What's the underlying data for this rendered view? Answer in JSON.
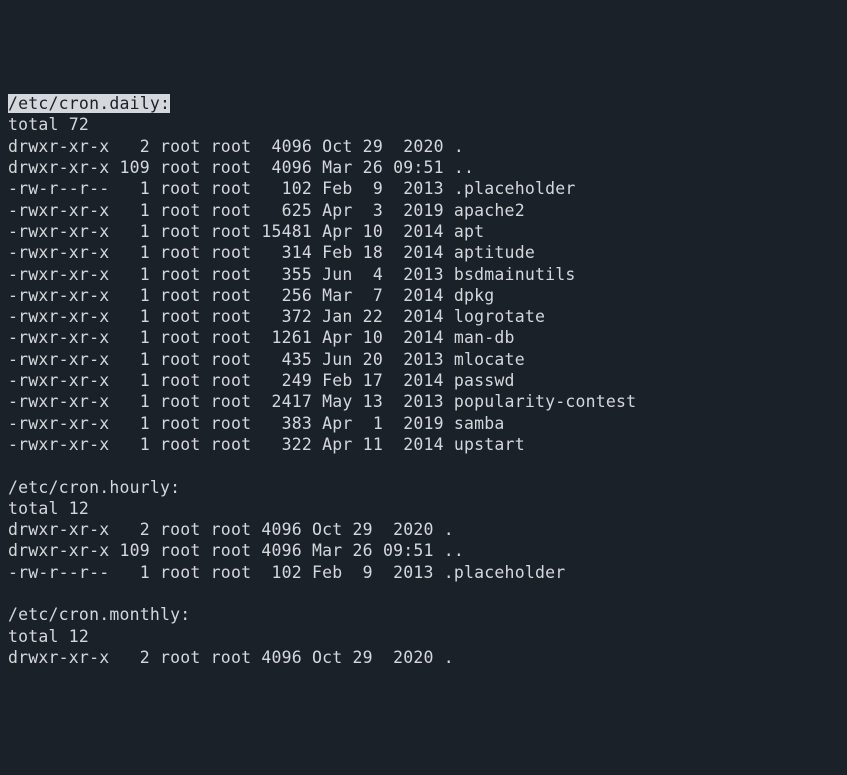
{
  "sections": [
    {
      "header": "/etc/cron.daily:",
      "highlighted": true,
      "total": "total 72",
      "rows": [
        {
          "perm": "drwxr-xr-x",
          "links": "2",
          "owner": "root",
          "group": "root",
          "size": "4096",
          "date": "Oct 29  2020",
          "name": "."
        },
        {
          "perm": "drwxr-xr-x",
          "links": "109",
          "owner": "root",
          "group": "root",
          "size": "4096",
          "date": "Mar 26 09:51",
          "name": ".."
        },
        {
          "perm": "-rw-r--r--",
          "links": "1",
          "owner": "root",
          "group": "root",
          "size": "102",
          "date": "Feb  9  2013",
          "name": ".placeholder"
        },
        {
          "perm": "-rwxr-xr-x",
          "links": "1",
          "owner": "root",
          "group": "root",
          "size": "625",
          "date": "Apr  3  2019",
          "name": "apache2"
        },
        {
          "perm": "-rwxr-xr-x",
          "links": "1",
          "owner": "root",
          "group": "root",
          "size": "15481",
          "date": "Apr 10  2014",
          "name": "apt"
        },
        {
          "perm": "-rwxr-xr-x",
          "links": "1",
          "owner": "root",
          "group": "root",
          "size": "314",
          "date": "Feb 18  2014",
          "name": "aptitude"
        },
        {
          "perm": "-rwxr-xr-x",
          "links": "1",
          "owner": "root",
          "group": "root",
          "size": "355",
          "date": "Jun  4  2013",
          "name": "bsdmainutils"
        },
        {
          "perm": "-rwxr-xr-x",
          "links": "1",
          "owner": "root",
          "group": "root",
          "size": "256",
          "date": "Mar  7  2014",
          "name": "dpkg"
        },
        {
          "perm": "-rwxr-xr-x",
          "links": "1",
          "owner": "root",
          "group": "root",
          "size": "372",
          "date": "Jan 22  2014",
          "name": "logrotate"
        },
        {
          "perm": "-rwxr-xr-x",
          "links": "1",
          "owner": "root",
          "group": "root",
          "size": "1261",
          "date": "Apr 10  2014",
          "name": "man-db"
        },
        {
          "perm": "-rwxr-xr-x",
          "links": "1",
          "owner": "root",
          "group": "root",
          "size": "435",
          "date": "Jun 20  2013",
          "name": "mlocate"
        },
        {
          "perm": "-rwxr-xr-x",
          "links": "1",
          "owner": "root",
          "group": "root",
          "size": "249",
          "date": "Feb 17  2014",
          "name": "passwd"
        },
        {
          "perm": "-rwxr-xr-x",
          "links": "1",
          "owner": "root",
          "group": "root",
          "size": "2417",
          "date": "May 13  2013",
          "name": "popularity-contest"
        },
        {
          "perm": "-rwxr-xr-x",
          "links": "1",
          "owner": "root",
          "group": "root",
          "size": "383",
          "date": "Apr  1  2019",
          "name": "samba"
        },
        {
          "perm": "-rwxr-xr-x",
          "links": "1",
          "owner": "root",
          "group": "root",
          "size": "322",
          "date": "Apr 11  2014",
          "name": "upstart"
        }
      ],
      "sizeWidth": 5
    },
    {
      "header": "/etc/cron.hourly:",
      "highlighted": false,
      "total": "total 12",
      "rows": [
        {
          "perm": "drwxr-xr-x",
          "links": "2",
          "owner": "root",
          "group": "root",
          "size": "4096",
          "date": "Oct 29  2020",
          "name": "."
        },
        {
          "perm": "drwxr-xr-x",
          "links": "109",
          "owner": "root",
          "group": "root",
          "size": "4096",
          "date": "Mar 26 09:51",
          "name": ".."
        },
        {
          "perm": "-rw-r--r--",
          "links": "1",
          "owner": "root",
          "group": "root",
          "size": "102",
          "date": "Feb  9  2013",
          "name": ".placeholder"
        }
      ],
      "sizeWidth": 4
    },
    {
      "header": "/etc/cron.monthly:",
      "highlighted": false,
      "total": "total 12",
      "rows": [
        {
          "perm": "drwxr-xr-x",
          "links": "2",
          "owner": "root",
          "group": "root",
          "size": "4096",
          "date": "Oct 29  2020",
          "name": "."
        }
      ],
      "sizeWidth": 4
    }
  ],
  "cursor": {
    "section": 1,
    "inHeader": true,
    "col": 13
  }
}
